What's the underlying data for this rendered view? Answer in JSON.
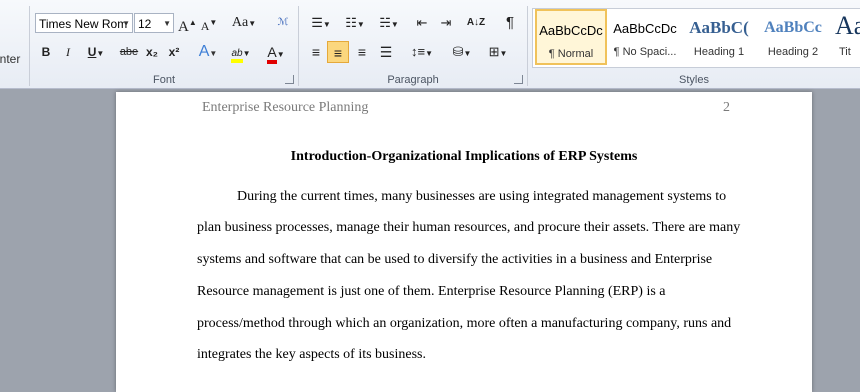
{
  "ribbon": {
    "clipboard": {
      "paint_label": "nter"
    },
    "font": {
      "name": "Times New Rom",
      "size": "12",
      "grow_label": "A",
      "shrink_label": "A",
      "case_label": "Aa",
      "bold_label": "B",
      "italic_label": "I",
      "underline_label": "U",
      "strike_label": "abe",
      "subscript_label": "x₂",
      "superscript_label": "x²",
      "effects_label": "A",
      "highlight_label": "ab",
      "color_label": "A",
      "group_label": "Font"
    },
    "paragraph": {
      "group_label": "Paragraph",
      "pilcrow": "¶",
      "sort": "A↓Z"
    },
    "styles": {
      "group_label": "Styles",
      "items": [
        {
          "sample": "AaBbCcDc",
          "name": "¶ Normal"
        },
        {
          "sample": "AaBbCcDc",
          "name": "¶ No Spaci..."
        },
        {
          "sample": "AaBbC(",
          "name": "Heading 1"
        },
        {
          "sample": "AaBbCc",
          "name": "Heading 2"
        },
        {
          "sample": "Aa",
          "name": "Tit"
        }
      ]
    },
    "colors": {
      "highlight": "#ffff00",
      "font_color": "#e00000"
    }
  },
  "document": {
    "header": "Enterprise Resource Planning",
    "page_number": "2",
    "title": "Introduction-Organizational Implications of ERP Systems",
    "lines": [
      "During the current times, many businesses are using integrated management systems to",
      "plan business processes, manage their human resources, and procure their assets. There are many",
      "systems and software that can be used to diversify the activities in a business and Enterprise",
      "Resource management is just one of them. Enterprise Resource Planning (ERP) is a",
      "process/method through which an organization, more often a manufacturing company, runs and",
      "integrates the key aspects of its business."
    ]
  }
}
